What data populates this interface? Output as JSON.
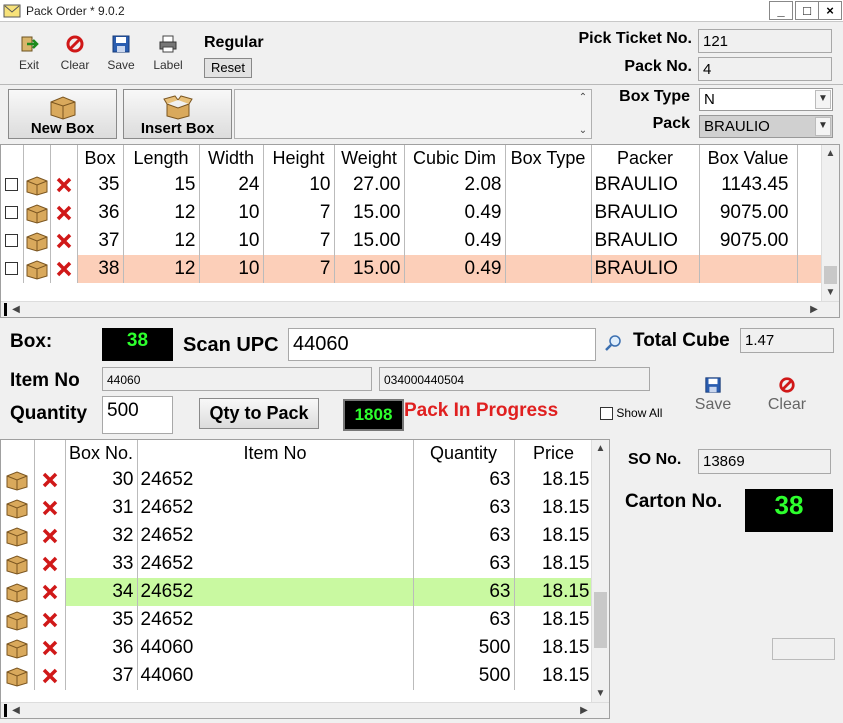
{
  "window": {
    "title": "Pack Order * 9.0.2",
    "minimize": "_",
    "maximize": "□",
    "close": "×"
  },
  "toolbar": {
    "exit": "Exit",
    "clear": "Clear",
    "save": "Save",
    "label": "Label",
    "mode": "Regular",
    "reset": "Reset"
  },
  "header": {
    "pick_ticket_label": "Pick Ticket No.",
    "pick_ticket_value": "121",
    "pack_no_label": "Pack  No.",
    "pack_no_value": "4"
  },
  "box_actions": {
    "new_box": "New Box",
    "insert_box": "Insert Box",
    "box_type_label": "Box Type",
    "box_type_value": "N",
    "pack_label": "Pack",
    "pack_value": "BRAULIO"
  },
  "boxes_grid": {
    "headers": [
      "Box",
      "Length",
      "Width",
      "Height",
      "Weight",
      "Cubic Dim",
      "Box Type",
      "Packer",
      "Box Value"
    ],
    "rows": [
      {
        "box": "35",
        "length": "15",
        "width": "24",
        "height": "10",
        "weight": "27.00",
        "cubic": "2.08",
        "type": "",
        "packer": "BRAULIO",
        "value": "1143.45"
      },
      {
        "box": "36",
        "length": "12",
        "width": "10",
        "height": "7",
        "weight": "15.00",
        "cubic": "0.49",
        "type": "",
        "packer": "BRAULIO",
        "value": "9075.00"
      },
      {
        "box": "37",
        "length": "12",
        "width": "10",
        "height": "7",
        "weight": "15.00",
        "cubic": "0.49",
        "type": "",
        "packer": "BRAULIO",
        "value": "9075.00"
      },
      {
        "box": "38",
        "length": "12",
        "width": "10",
        "height": "7",
        "weight": "15.00",
        "cubic": "0.49",
        "type": "",
        "packer": "BRAULIO",
        "value": ""
      }
    ]
  },
  "scan": {
    "box_label": "Box:",
    "box_value": "38",
    "scan_upc_label": "Scan UPC",
    "scan_upc_value": "44060",
    "total_cube_label": "Total Cube",
    "total_cube_value": "1.47",
    "item_no_label": "Item No",
    "item_no_value": "44060",
    "upc_value": "034000440504",
    "quantity_label": "Quantity",
    "quantity_value": "500",
    "qty_to_pack": "Qty to Pack",
    "counter": "1808",
    "status": "Pack In Progress",
    "show_all": "Show All",
    "save": "Save",
    "clear": "Clear"
  },
  "items_grid": {
    "headers": [
      "Box No.",
      "Item No",
      "Quantity",
      "Price"
    ],
    "rows": [
      {
        "box": "30",
        "item": "24652",
        "qty": "63",
        "price": "18.15"
      },
      {
        "box": "31",
        "item": "24652",
        "qty": "63",
        "price": "18.15"
      },
      {
        "box": "32",
        "item": "24652",
        "qty": "63",
        "price": "18.15"
      },
      {
        "box": "33",
        "item": "24652",
        "qty": "63",
        "price": "18.15"
      },
      {
        "box": "34",
        "item": "24652",
        "qty": "63",
        "price": "18.15"
      },
      {
        "box": "35",
        "item": "24652",
        "qty": "63",
        "price": "18.15"
      },
      {
        "box": "36",
        "item": "44060",
        "qty": "500",
        "price": "18.15"
      },
      {
        "box": "37",
        "item": "44060",
        "qty": "500",
        "price": "18.15"
      }
    ]
  },
  "side": {
    "so_label": "SO  No.",
    "so_value": "13869",
    "carton_label": "Carton No.",
    "carton_value": "38"
  },
  "colors": {
    "selected_box_row": "#fccfb9",
    "selected_item_row": "#c9f9a1",
    "counter_text": "#2dff2d",
    "status_text": "#e02020"
  }
}
